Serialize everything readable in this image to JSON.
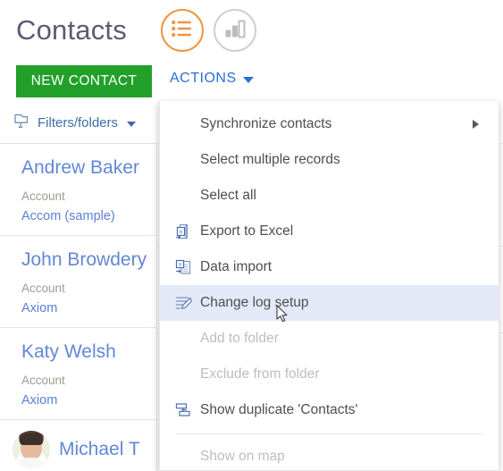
{
  "header": {
    "page_title": "Contacts",
    "view_toggles": [
      {
        "name": "list-view",
        "icon": "list-icon",
        "active": true,
        "color": "#f0953f"
      },
      {
        "name": "chart-view",
        "icon": "bar-chart-icon",
        "active": false,
        "color": "#cfcfcf"
      }
    ],
    "new_contact_label": "NEW CONTACT",
    "new_contact_color": "#22a02a",
    "actions_label": "ACTIONS",
    "actions_color": "#2a6fd6",
    "actions_caret_icon": "caret-down-icon"
  },
  "filters": {
    "label": "Filters/folders",
    "icon": "folder-filter-icon",
    "caret_icon": "caret-down-icon"
  },
  "contacts": [
    {
      "name": "Andrew Baker",
      "field_label": "Account",
      "field_value": "Accom (sample)",
      "has_avatar": false
    },
    {
      "name": "John Browdery",
      "field_label": "Account",
      "field_value": "Axiom",
      "has_avatar": false
    },
    {
      "name": "Katy Welsh",
      "field_label": "Account",
      "field_value": "Axiom",
      "has_avatar": false
    },
    {
      "name": "Michael T",
      "field_label": "",
      "field_value": "",
      "has_avatar": true
    }
  ],
  "menu": {
    "items": [
      {
        "label": "Synchronize contacts",
        "icon": null,
        "disabled": false,
        "highlighted": false,
        "submenu": true
      },
      {
        "label": "Select multiple records",
        "icon": null,
        "disabled": false,
        "highlighted": false,
        "submenu": false
      },
      {
        "label": "Select all",
        "icon": null,
        "disabled": false,
        "highlighted": false,
        "submenu": false
      },
      {
        "label": "Export to Excel",
        "icon": "export-excel-icon",
        "disabled": false,
        "highlighted": false,
        "submenu": false
      },
      {
        "label": "Data import",
        "icon": "data-import-icon",
        "disabled": false,
        "highlighted": false,
        "submenu": false
      },
      {
        "label": "Change log setup",
        "icon": "change-log-icon",
        "disabled": false,
        "highlighted": true,
        "submenu": false
      },
      {
        "label": "Add to folder",
        "icon": null,
        "disabled": true,
        "highlighted": false,
        "submenu": false
      },
      {
        "label": "Exclude from folder",
        "icon": null,
        "disabled": true,
        "highlighted": false,
        "submenu": false
      },
      {
        "label": "Show duplicate 'Contacts'",
        "icon": "duplicate-icon",
        "disabled": false,
        "highlighted": false,
        "submenu": false
      },
      {
        "label": "Show on map",
        "icon": null,
        "disabled": true,
        "highlighted": false,
        "submenu": false
      }
    ],
    "separator_after_index": 8,
    "highlight_color": "#e4e9f7"
  },
  "cursor": {
    "icon": "mouse-pointer-icon"
  }
}
